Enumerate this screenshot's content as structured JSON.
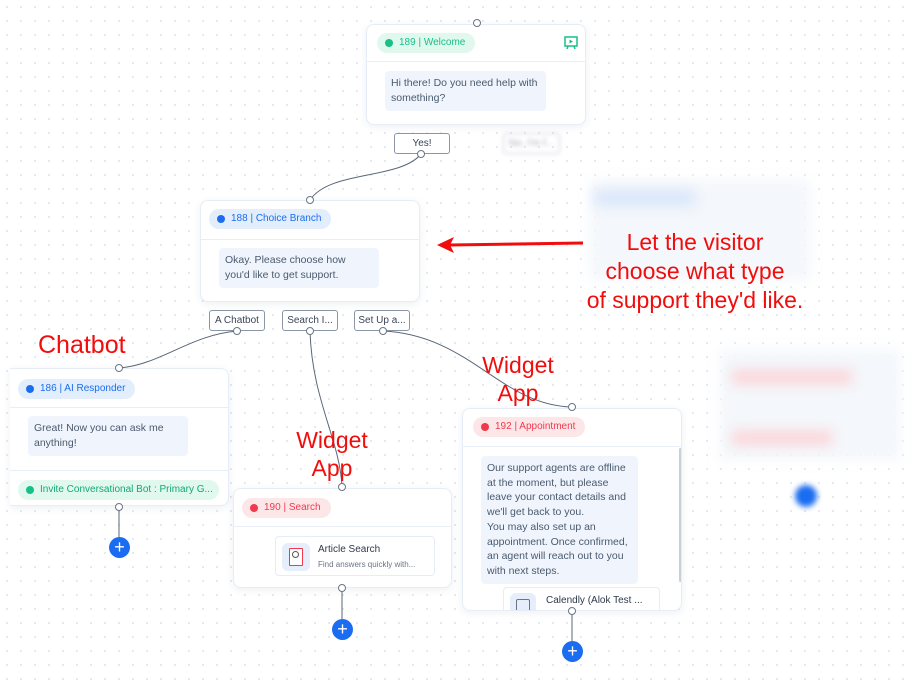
{
  "nodes": {
    "welcome": {
      "badge": "189 | Welcome",
      "message": "Hi there! Do you need help with something?",
      "icon": "preview-icon",
      "color": "#17c08a"
    },
    "choice": {
      "badge": "188 | Choice Branch",
      "message": "Okay. Please choose how you'd like to get support.",
      "color": "#1a6df0"
    },
    "ai": {
      "badge": "186 | AI Responder",
      "message": "Great! Now you can ask me anything!",
      "action": "Invite Conversational Bot : Primary G...",
      "color": "#1a6df0"
    },
    "search": {
      "badge": "190 | Search",
      "card_title": "Article Search",
      "card_sub": "Find answers quickly with...",
      "color": "#f0394d"
    },
    "appointment": {
      "badge": "192 | Appointment",
      "message": "Our support agents are offline at the moment, but please leave your contact details and we'll get back to you.\nYou may also set up an appointment. Once confirmed, an agent will reach out to you with next steps.",
      "card_title": "Calendly (Alok Test ...",
      "color": "#f0394d"
    }
  },
  "options": {
    "yes": "Yes!",
    "no": "No, I'm f...",
    "chatbot": "A Chatbot",
    "search": "Search I...",
    "setup": "Set Up a..."
  },
  "annotations": {
    "main": "Let the visitor choose what type of support they'd like.",
    "line1": "Let the visitor",
    "line2": "choose what type",
    "line3": "of support they'd like.",
    "chatbot": "Chatbot",
    "widget1a": "Widget",
    "widget1b": "App",
    "widget2a": "Widget",
    "widget2b": "App",
    "color": "#f20d0d"
  }
}
